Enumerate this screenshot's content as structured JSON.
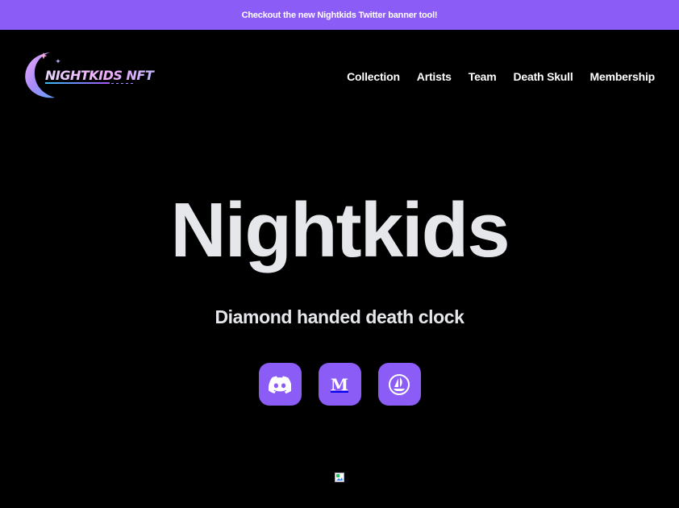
{
  "announcement": {
    "text": "Checkout the new Nightkids Twitter banner tool!"
  },
  "header": {
    "logo_alt": "Nightkids NFT logo",
    "logo_wordmark": "NIGHTKIDS NFT",
    "nav": [
      {
        "label": "Collection"
      },
      {
        "label": "Artists"
      },
      {
        "label": "Team"
      },
      {
        "label": "Death Skull"
      },
      {
        "label": "Membership"
      }
    ]
  },
  "hero": {
    "title": "Nightkids",
    "subtitle": "Diamond handed death clock"
  },
  "socials": [
    {
      "name": "Discord",
      "icon": "discord-icon"
    },
    {
      "name": "Medium",
      "icon": "medium-icon",
      "glyph": "M"
    },
    {
      "name": "OpenSea",
      "icon": "opensea-icon"
    }
  ],
  "colors": {
    "accent": "#8b5cf6",
    "background": "#000000",
    "text": "#e5e7eb"
  }
}
